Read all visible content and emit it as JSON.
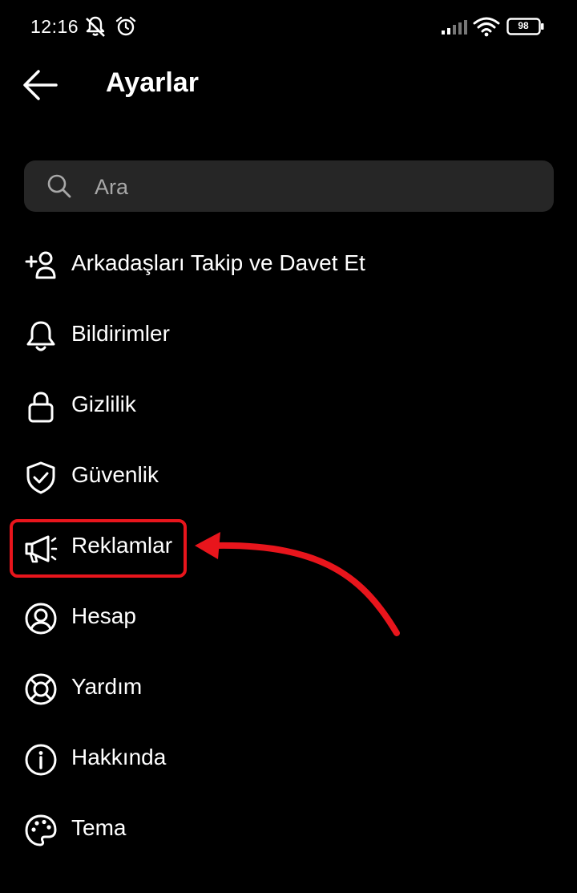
{
  "status_bar": {
    "time": "12:16",
    "battery_level": "98",
    "icons": [
      "mute-notifications-icon",
      "alarm-icon",
      "signal-icon",
      "wifi-icon",
      "battery-icon"
    ]
  },
  "header": {
    "title": "Ayarlar",
    "back_icon": "arrow-left-icon"
  },
  "search": {
    "placeholder": "Ara",
    "value": ""
  },
  "menu": {
    "items": [
      {
        "label": "Arkadaşları Takip ve Davet Et",
        "icon": "add-person-icon"
      },
      {
        "label": "Bildirimler",
        "icon": "bell-icon"
      },
      {
        "label": "Gizlilik",
        "icon": "lock-icon"
      },
      {
        "label": "Güvenlik",
        "icon": "shield-check-icon"
      },
      {
        "label": "Reklamlar",
        "icon": "megaphone-icon"
      },
      {
        "label": "Hesap",
        "icon": "account-circle-icon"
      },
      {
        "label": "Yardım",
        "icon": "lifebuoy-icon"
      },
      {
        "label": "Hakkında",
        "icon": "info-icon"
      },
      {
        "label": "Tema",
        "icon": "palette-icon"
      }
    ]
  },
  "annotation": {
    "highlighted_item": "Reklamlar",
    "color": "#e8151c"
  },
  "colors": {
    "background": "#000000",
    "text": "#ffffff",
    "search_background": "#262626",
    "placeholder": "#a8a8a8"
  }
}
